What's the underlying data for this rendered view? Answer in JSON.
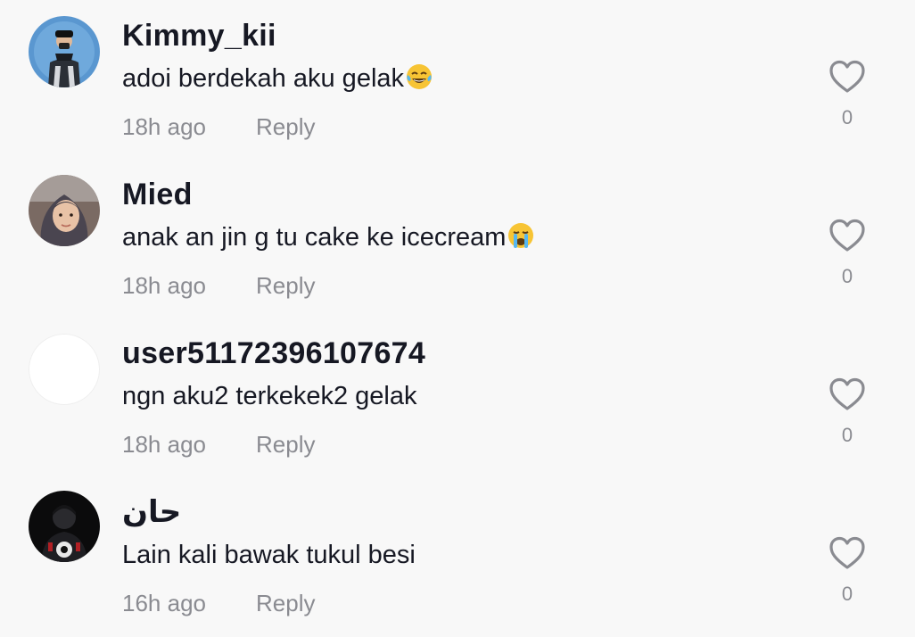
{
  "comments": [
    {
      "username": "Kimmy_kii",
      "text": "adoi berdekah aku gelak",
      "emoji": "tears-of-joy-emoji",
      "time": "18h ago",
      "reply_label": "Reply",
      "like_count": "0",
      "avatar": "avatar-man-cap"
    },
    {
      "username": "Mied",
      "text": "anak an jin g tu cake ke icecream",
      "emoji": "crying-face-emoji",
      "time": "18h ago",
      "reply_label": "Reply",
      "like_count": "0",
      "avatar": "avatar-woman-hijab"
    },
    {
      "username": "user51172396107674",
      "text": "ngn aku2 terkekek2 gelak",
      "time": "18h ago",
      "reply_label": "Reply",
      "like_count": "0",
      "avatar": "avatar-blank"
    },
    {
      "username": "حان",
      "text": "Lain kali bawak tukul besi",
      "time": "16h ago",
      "reply_label": "Reply",
      "like_count": "0",
      "avatar": "avatar-dark-figure"
    }
  ],
  "colors": {
    "background": "#f8f8f8",
    "primary_text": "#161823",
    "secondary_text": "#8a8b91",
    "icon_gray": "#8a8b91"
  }
}
